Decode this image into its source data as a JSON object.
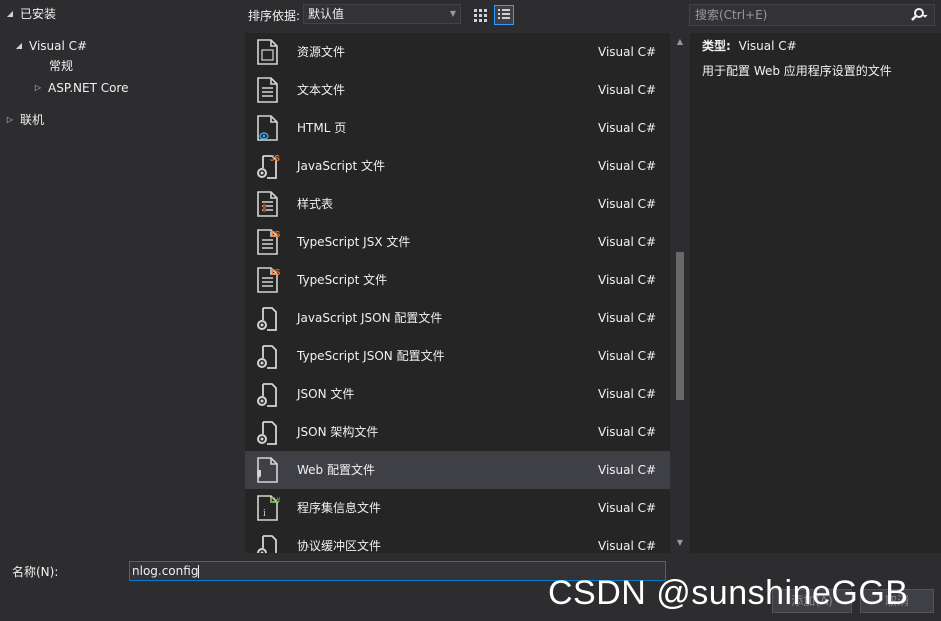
{
  "tree": {
    "installed": "已安装",
    "visual_csharp": "Visual C#",
    "general": "常规",
    "aspnet_core": "ASP.NET Core",
    "online": "联机"
  },
  "toolbar": {
    "sort_label": "排序依据:",
    "sort_value": "默认值",
    "search_placeholder": "搜索(Ctrl+E)"
  },
  "items": [
    {
      "name": "资源文件",
      "lang": "Visual C#",
      "icon": "resource-file-icon"
    },
    {
      "name": "文本文件",
      "lang": "Visual C#",
      "icon": "text-file-icon"
    },
    {
      "name": "HTML 页",
      "lang": "Visual C#",
      "icon": "html-page-icon"
    },
    {
      "name": "JavaScript 文件",
      "lang": "Visual C#",
      "icon": "javascript-file-icon"
    },
    {
      "name": "样式表",
      "lang": "Visual C#",
      "icon": "stylesheet-icon"
    },
    {
      "name": "TypeScript JSX 文件",
      "lang": "Visual C#",
      "icon": "typescript-jsx-file-icon"
    },
    {
      "name": "TypeScript 文件",
      "lang": "Visual C#",
      "icon": "typescript-file-icon"
    },
    {
      "name": "JavaScript JSON 配置文件",
      "lang": "Visual C#",
      "icon": "json-config-icon"
    },
    {
      "name": "TypeScript JSON 配置文件",
      "lang": "Visual C#",
      "icon": "json-config-icon"
    },
    {
      "name": "JSON 文件",
      "lang": "Visual C#",
      "icon": "json-file-icon"
    },
    {
      "name": "JSON 架构文件",
      "lang": "Visual C#",
      "icon": "json-schema-icon"
    },
    {
      "name": "Web 配置文件",
      "lang": "Visual C#",
      "icon": "web-config-icon"
    },
    {
      "name": "程序集信息文件",
      "lang": "Visual C#",
      "icon": "assembly-info-icon"
    },
    {
      "name": "协议缓冲区文件",
      "lang": "Visual C#",
      "icon": "protocol-buffer-icon"
    }
  ],
  "selected_index": 11,
  "details": {
    "type_label": "类型:",
    "type_value": "Visual C#",
    "description": "用于配置 Web 应用程序设置的文件"
  },
  "bottom": {
    "name_label": "名称(N):",
    "name_value": "nlog.config",
    "add_label": "添加(A)",
    "cancel_label": "取消"
  },
  "watermark": "CSDN @sunshineGGB",
  "colors": {
    "accent": "#007acc",
    "selection": "#3f3f46",
    "ts_badge": "#f47920",
    "cs_badge": "#68b723",
    "html_badge": "#3ba9e8",
    "background": "#2d2d30",
    "panel": "#252526"
  }
}
